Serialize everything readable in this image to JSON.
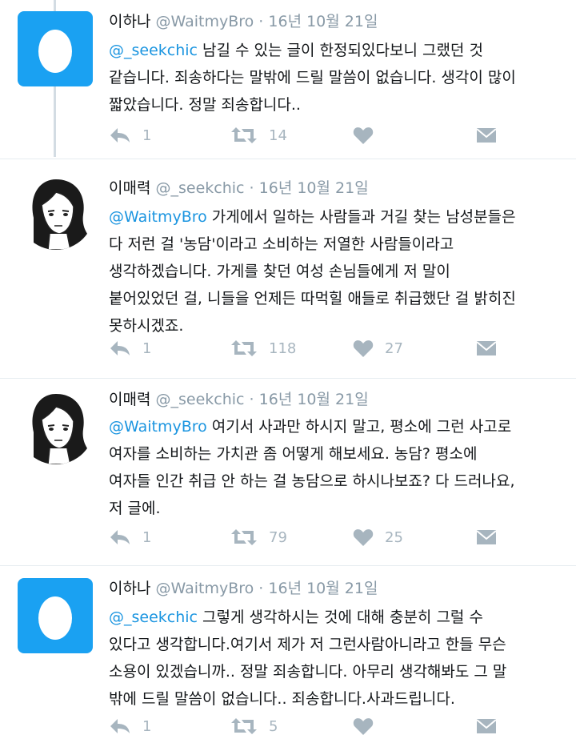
{
  "tweets": [
    {
      "avatar": "egg-avatar",
      "name": "이하나",
      "handle": "@WaitmyBro",
      "dot": "·",
      "date": "16년 10월 21일",
      "mention": "@_seekchic",
      "text": " 남길 수 있는 글이 한정되있다보니 그랬던 것\n같습니다. 죄송하다는 말밖에 드릴 말씀이 없습니다. 생각이 많이\n짧았습니다. 정말 죄송합니다..",
      "reply_count": "1",
      "retweet_count": "14",
      "like_count": ""
    },
    {
      "avatar": "drawn-avatar",
      "name": "이매력",
      "handle": "@_seekchic",
      "dot": "·",
      "date": "16년 10월 21일",
      "mention": "@WaitmyBro",
      "text": " 가게에서 일하는 사람들과 거길 찾는 남성분들은\n다 저런 걸 '농담'이라고 소비하는 저열한 사람들이라고\n생각하겠습니다. 가게를 찾던 여성 손님들에게 저 말이\n붙어있었던 걸, 니들을 언제든 따먹힐 애들로 취급했단 걸 밝히진\n못하시겠죠.",
      "reply_count": "1",
      "retweet_count": "118",
      "like_count": "27"
    },
    {
      "avatar": "drawn-avatar",
      "name": "이매력",
      "handle": "@_seekchic",
      "dot": "·",
      "date": "16년 10월 21일",
      "mention": "@WaitmyBro",
      "text": " 여기서 사과만 하시지 말고, 평소에 그런 사고로\n여자를 소비하는 가치관 좀 어떻게 해보세요. 농담? 평소에\n여자들 인간 취급 안 하는 걸 농담으로 하시나보죠? 다 드러나요,\n저 글에.",
      "reply_count": "1",
      "retweet_count": "79",
      "like_count": "25"
    },
    {
      "avatar": "egg-avatar",
      "name": "이하나",
      "handle": "@WaitmyBro",
      "dot": "·",
      "date": "16년 10월 21일",
      "mention": "@_seekchic",
      "text": " 그렇게 생각하시는 것에 대해 충분히 그럴 수\n있다고 생각합니다.여기서 제가 저 그런사람아니라고 한들 무슨\n소용이 있겠습니까.. 정말 죄송합니다. 아무리 생각해봐도 그 말\n밖에 드릴 말씀이 없습니다.. 죄송합니다.사과드립니다.",
      "reply_count": "1",
      "retweet_count": "5",
      "like_count": ""
    }
  ],
  "colors": {
    "mention": "#1b95e0",
    "egg_bg": "#1aa1f2",
    "meta": "#8899a6",
    "action": "#a7b5bf",
    "thread_line": "#d3dce3"
  },
  "icons": [
    "reply-icon",
    "retweet-icon",
    "like-icon",
    "dm-icon",
    "egg-icon"
  ]
}
